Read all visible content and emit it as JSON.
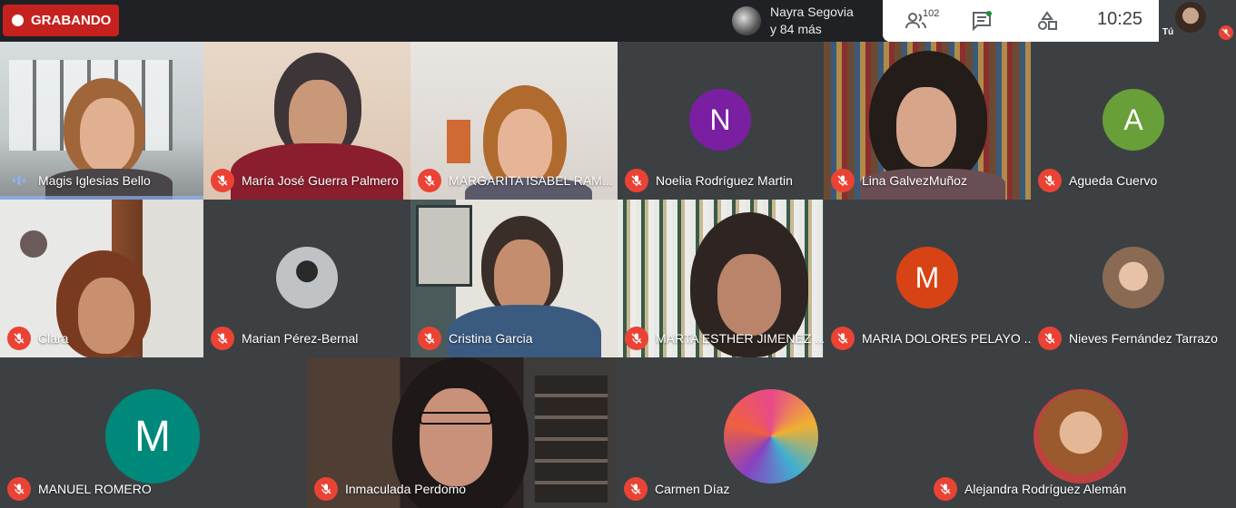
{
  "recording": {
    "label": "GRABANDO"
  },
  "presenter": {
    "line1": "Nayra Segovia",
    "line2": "y 84 más"
  },
  "toolbar": {
    "participants_count": "102",
    "clock": "10:25"
  },
  "self": {
    "label": "Tú"
  },
  "colors": {
    "record_red": "#c5221f",
    "muted_red": "#ea4335",
    "tile_bg": "#3c4043",
    "bg": "#202124"
  },
  "participants": [
    {
      "name": "Magis Iglesias Bello",
      "status": "speaking"
    },
    {
      "name": "María José Guerra Palmero",
      "status": "muted"
    },
    {
      "name": "MARGARITA ISABEL RAM...",
      "status": "muted"
    },
    {
      "name": "Noelia Rodríguez Martin",
      "status": "muted",
      "initial": "N",
      "avatar_color": "#7b1fa2"
    },
    {
      "name": "Lina GalvezMuñoz",
      "status": "muted"
    },
    {
      "name": "Agueda Cuervo",
      "status": "muted",
      "initial": "A",
      "avatar_color": "#689f38"
    },
    {
      "name": "Clara",
      "status": "muted"
    },
    {
      "name": "Marian Pérez-Bernal",
      "status": "muted"
    },
    {
      "name": "Cristina Garcia",
      "status": "muted"
    },
    {
      "name": "MARTA ESTHER JIMENEZ ...",
      "status": "muted"
    },
    {
      "name": "MARIA DOLORES PELAYO ...",
      "status": "muted",
      "initial": "M",
      "avatar_color": "#d84315"
    },
    {
      "name": "Nieves Fernández Tarrazo",
      "status": "muted"
    },
    {
      "name": "MANUEL ROMERO",
      "status": "muted",
      "initial": "M",
      "avatar_color": "#00897b"
    },
    {
      "name": "Inmaculada Perdomo",
      "status": "muted"
    },
    {
      "name": "Carmen Díaz",
      "status": "muted"
    },
    {
      "name": "Alejandra Rodríguez Alemán",
      "status": "muted"
    }
  ]
}
